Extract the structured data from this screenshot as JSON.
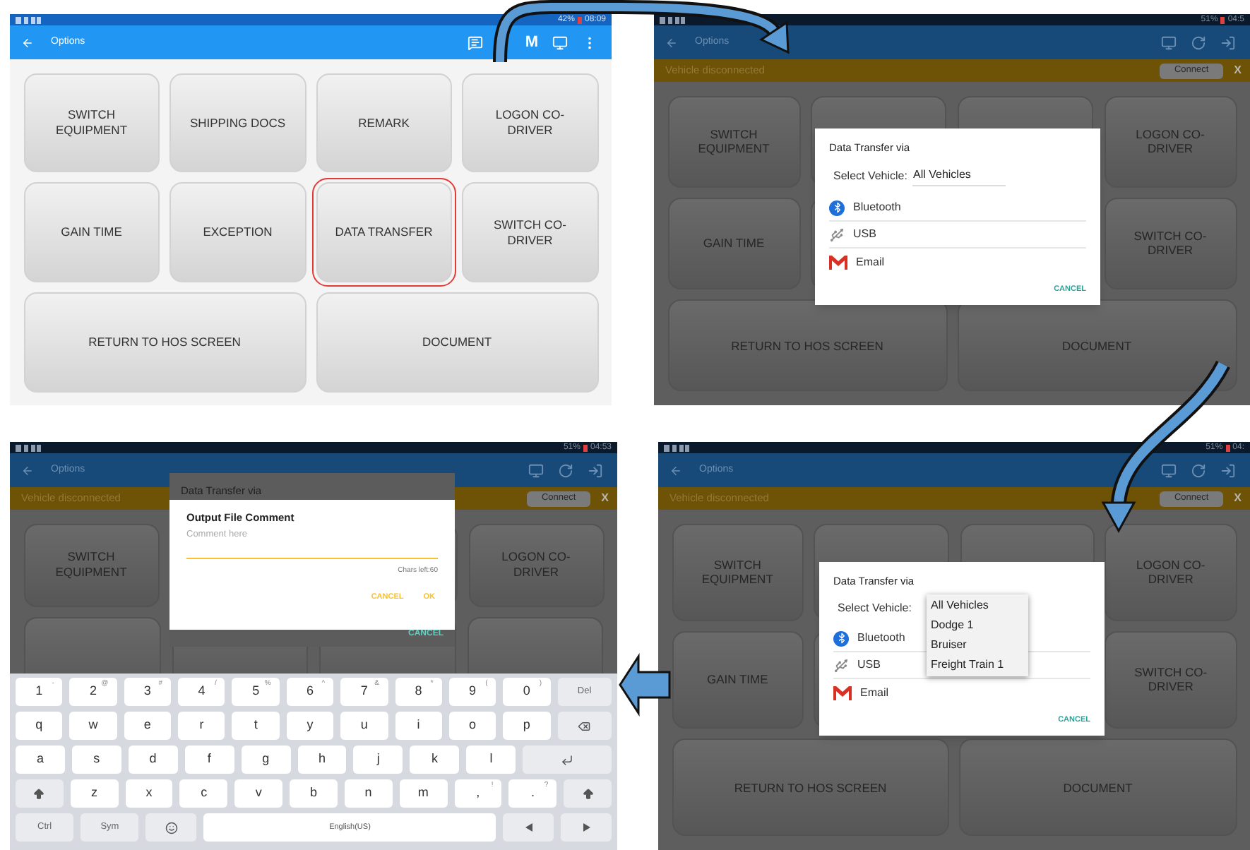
{
  "panels": [
    {
      "dimmed": false,
      "status": {
        "battery": "42%",
        "time": "08:09"
      },
      "toolbar": {
        "title": "Options",
        "actions": [
          {
            "kind": "chat"
          },
          {
            "kind": "letter",
            "text": "M"
          },
          {
            "kind": "monitor"
          },
          {
            "kind": "more"
          }
        ]
      },
      "buttons": [
        {
          "kind": "full",
          "items": [
            {
              "label": "SWITCH EQUIPMENT",
              "selected": false
            },
            {
              "label": "SHIPPING DOCS",
              "selected": false
            },
            {
              "label": "REMARK",
              "selected": false
            },
            {
              "label": "LOGON CO-DRIVER",
              "selected": false
            }
          ]
        },
        {
          "kind": "full",
          "items": [
            {
              "label": "GAIN TIME",
              "selected": false
            },
            {
              "label": "EXCEPTION",
              "selected": false
            },
            {
              "label": "DATA TRANSFER",
              "selected": true
            },
            {
              "label": "SWITCH CO-DRIVER",
              "selected": false
            }
          ]
        },
        {
          "kind": "full",
          "items": [
            {
              "label": "RETURN TO HOS SCREEN",
              "selected": false
            },
            {
              "label": "DOCUMENT",
              "selected": false
            }
          ]
        }
      ]
    },
    {
      "dimmed": true,
      "status": {
        "battery": "51%",
        "time": "04:5"
      },
      "toolbar": {
        "title": "Options",
        "actions": [
          {
            "kind": "monitor"
          },
          {
            "kind": "refresh"
          },
          {
            "kind": "logout"
          }
        ]
      },
      "banner": {
        "text": "Vehicle disconnected",
        "button": "Connect",
        "close": "X"
      },
      "buttons": [
        {
          "kind": "ends",
          "items": [
            {
              "label": "SWITCH EQUIPMENT"
            },
            {
              "label": "LOGON CO-DRIVER"
            }
          ]
        },
        {
          "kind": "ends",
          "items": [
            {
              "label": "GAIN TIME"
            },
            {
              "label": "SWITCH CO-DRIVER"
            }
          ]
        },
        {
          "kind": "full",
          "items": [
            {
              "label": "RETURN TO HOS SCREEN"
            },
            {
              "label": "DOCUMENT"
            }
          ]
        }
      ],
      "dialog": {
        "kind": "transfer",
        "title": "Data Transfer via",
        "select_label": "Select Vehicle:",
        "select_value": "All Vehicles",
        "options": [
          {
            "kind": "bluetooth",
            "label": "Bluetooth"
          },
          {
            "kind": "usb",
            "label": "USB"
          },
          {
            "kind": "email",
            "label": "Email"
          }
        ],
        "cancel": "CANCEL"
      }
    },
    {
      "dimmed": true,
      "status": {
        "battery": "51%",
        "time": "04:53"
      },
      "toolbar": {
        "title": "Options",
        "actions": [
          {
            "kind": "monitor"
          },
          {
            "kind": "refresh"
          },
          {
            "kind": "logout"
          }
        ]
      },
      "banner": {
        "text": "Vehicle disconnected",
        "button": "Connect",
        "close": "X"
      },
      "buttons": [
        {
          "kind": "ends",
          "items": [
            {
              "label": "SWITCH EQUIPMENT"
            },
            {
              "label": "LOGON CO-DRIVER"
            }
          ]
        },
        {
          "kind": "blank"
        }
      ],
      "dialog": {
        "kind": "comment",
        "behind": {
          "title": "Data Transfer via",
          "cancel": "CANCEL"
        },
        "title": "Output File Comment",
        "placeholder": "Comment here",
        "counter": "Chars left:60",
        "actions": [
          "CANCEL",
          "OK"
        ]
      },
      "keyboard": [
        [
          {
            "kind": "char",
            "label": "1",
            "alt": "-"
          },
          {
            "kind": "char",
            "label": "2",
            "alt": "@"
          },
          {
            "kind": "char",
            "label": "3",
            "alt": "#"
          },
          {
            "kind": "char",
            "label": "4",
            "alt": "/"
          },
          {
            "kind": "char",
            "label": "5",
            "alt": "%"
          },
          {
            "kind": "char",
            "label": "6",
            "alt": "^"
          },
          {
            "kind": "char",
            "label": "7",
            "alt": "&"
          },
          {
            "kind": "char",
            "label": "8",
            "alt": "*"
          },
          {
            "kind": "char",
            "label": "9",
            "alt": "("
          },
          {
            "kind": "char",
            "label": "0",
            "alt": ")"
          },
          {
            "kind": "func",
            "label": "Del"
          }
        ],
        [
          {
            "kind": "char",
            "label": "q"
          },
          {
            "kind": "char",
            "label": "w"
          },
          {
            "kind": "char",
            "label": "e"
          },
          {
            "kind": "char",
            "label": "r"
          },
          {
            "kind": "char",
            "label": "t"
          },
          {
            "kind": "char",
            "label": "y"
          },
          {
            "kind": "char",
            "label": "u"
          },
          {
            "kind": "char",
            "label": "i"
          },
          {
            "kind": "char",
            "label": "o"
          },
          {
            "kind": "char",
            "label": "p"
          },
          {
            "kind": "backspace"
          }
        ],
        [
          {
            "kind": "char",
            "label": "a"
          },
          {
            "kind": "char",
            "label": "s"
          },
          {
            "kind": "char",
            "label": "d"
          },
          {
            "kind": "char",
            "label": "f"
          },
          {
            "kind": "char",
            "label": "g"
          },
          {
            "kind": "char",
            "label": "h"
          },
          {
            "kind": "char",
            "label": "j"
          },
          {
            "kind": "char",
            "label": "k"
          },
          {
            "kind": "char",
            "label": "l"
          },
          {
            "kind": "enter"
          }
        ],
        [
          {
            "kind": "shift"
          },
          {
            "kind": "char",
            "label": "z"
          },
          {
            "kind": "char",
            "label": "x"
          },
          {
            "kind": "char",
            "label": "c"
          },
          {
            "kind": "char",
            "label": "v"
          },
          {
            "kind": "char",
            "label": "b"
          },
          {
            "kind": "char",
            "label": "n"
          },
          {
            "kind": "char",
            "label": "m"
          },
          {
            "kind": "char",
            "label": ",",
            "alt": "!"
          },
          {
            "kind": "char",
            "label": ".",
            "alt": "?"
          },
          {
            "kind": "shift"
          }
        ],
        [
          {
            "kind": "func",
            "label": "Ctrl"
          },
          {
            "kind": "func",
            "label": "Sym"
          },
          {
            "kind": "emoji"
          },
          {
            "kind": "space",
            "label": "English(US)"
          },
          {
            "kind": "left"
          },
          {
            "kind": "right"
          }
        ]
      ]
    },
    {
      "dimmed": true,
      "status": {
        "battery": "51%",
        "time": "04:"
      },
      "toolbar": {
        "title": "Options",
        "actions": [
          {
            "kind": "monitor"
          },
          {
            "kind": "refresh"
          },
          {
            "kind": "logout"
          }
        ]
      },
      "banner": {
        "text": "Vehicle disconnected",
        "button": "Connect",
        "close": "X"
      },
      "buttons": [
        {
          "kind": "ends",
          "items": [
            {
              "label": "SWITCH EQUIPMENT"
            },
            {
              "label": "LOGON CO-DRIVER"
            }
          ]
        },
        {
          "kind": "ends",
          "items": [
            {
              "label": "GAIN TIME"
            },
            {
              "label": "SWITCH CO-DRIVER"
            }
          ]
        },
        {
          "kind": "full",
          "items": [
            {
              "label": "RETURN TO HOS SCREEN"
            },
            {
              "label": "DOCUMENT"
            }
          ]
        }
      ],
      "dialog": {
        "kind": "transfer",
        "title": "Data Transfer via",
        "select_label": "Select Vehicle:",
        "dropdown": [
          "All Vehicles",
          "Dodge 1",
          "Bruiser",
          "Freight Train 1"
        ],
        "options": [
          {
            "kind": "bluetooth",
            "label": "Bluetooth"
          },
          {
            "kind": "usb",
            "label": "USB"
          },
          {
            "kind": "email",
            "label": "Email"
          }
        ],
        "cancel": "CANCEL"
      }
    }
  ]
}
